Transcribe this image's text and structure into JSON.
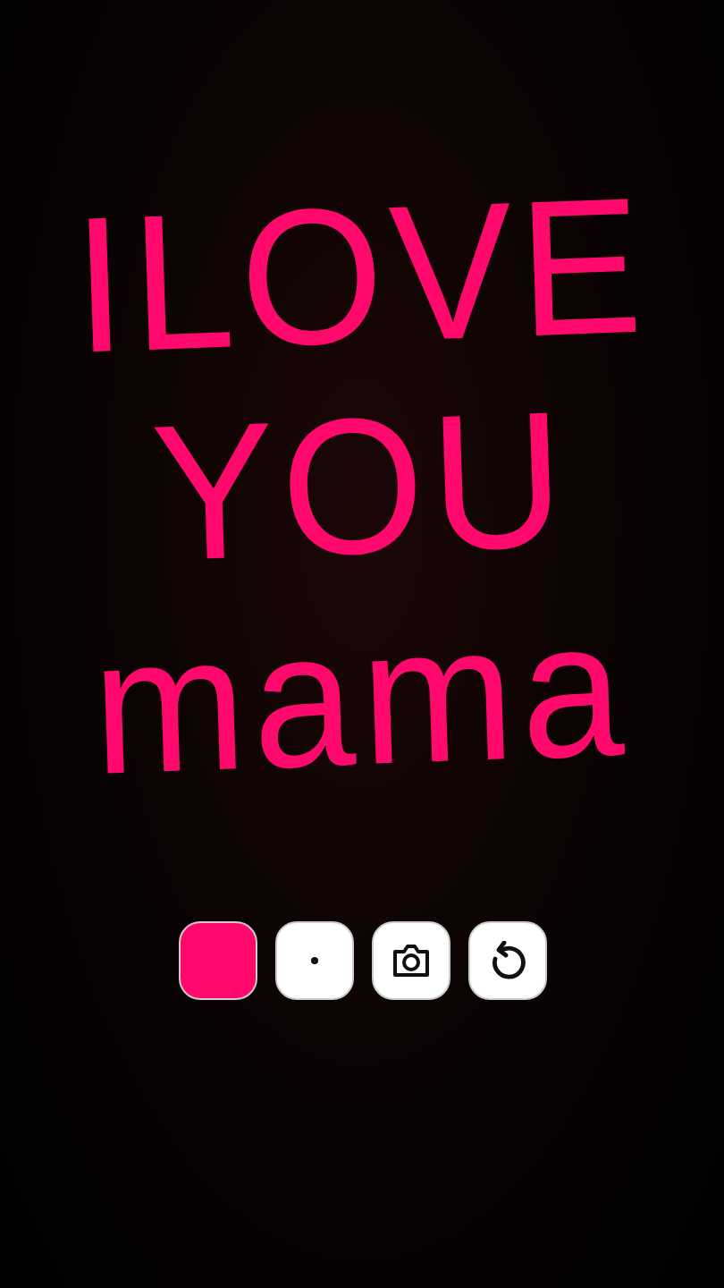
{
  "canvas": {
    "lines": [
      "ILOVE",
      "YOU",
      "mama"
    ]
  },
  "toolbar": [
    {
      "kind": "color",
      "color": "#ff0a6c"
    },
    {
      "kind": "brush"
    },
    {
      "kind": "camera"
    },
    {
      "kind": "undo"
    }
  ]
}
